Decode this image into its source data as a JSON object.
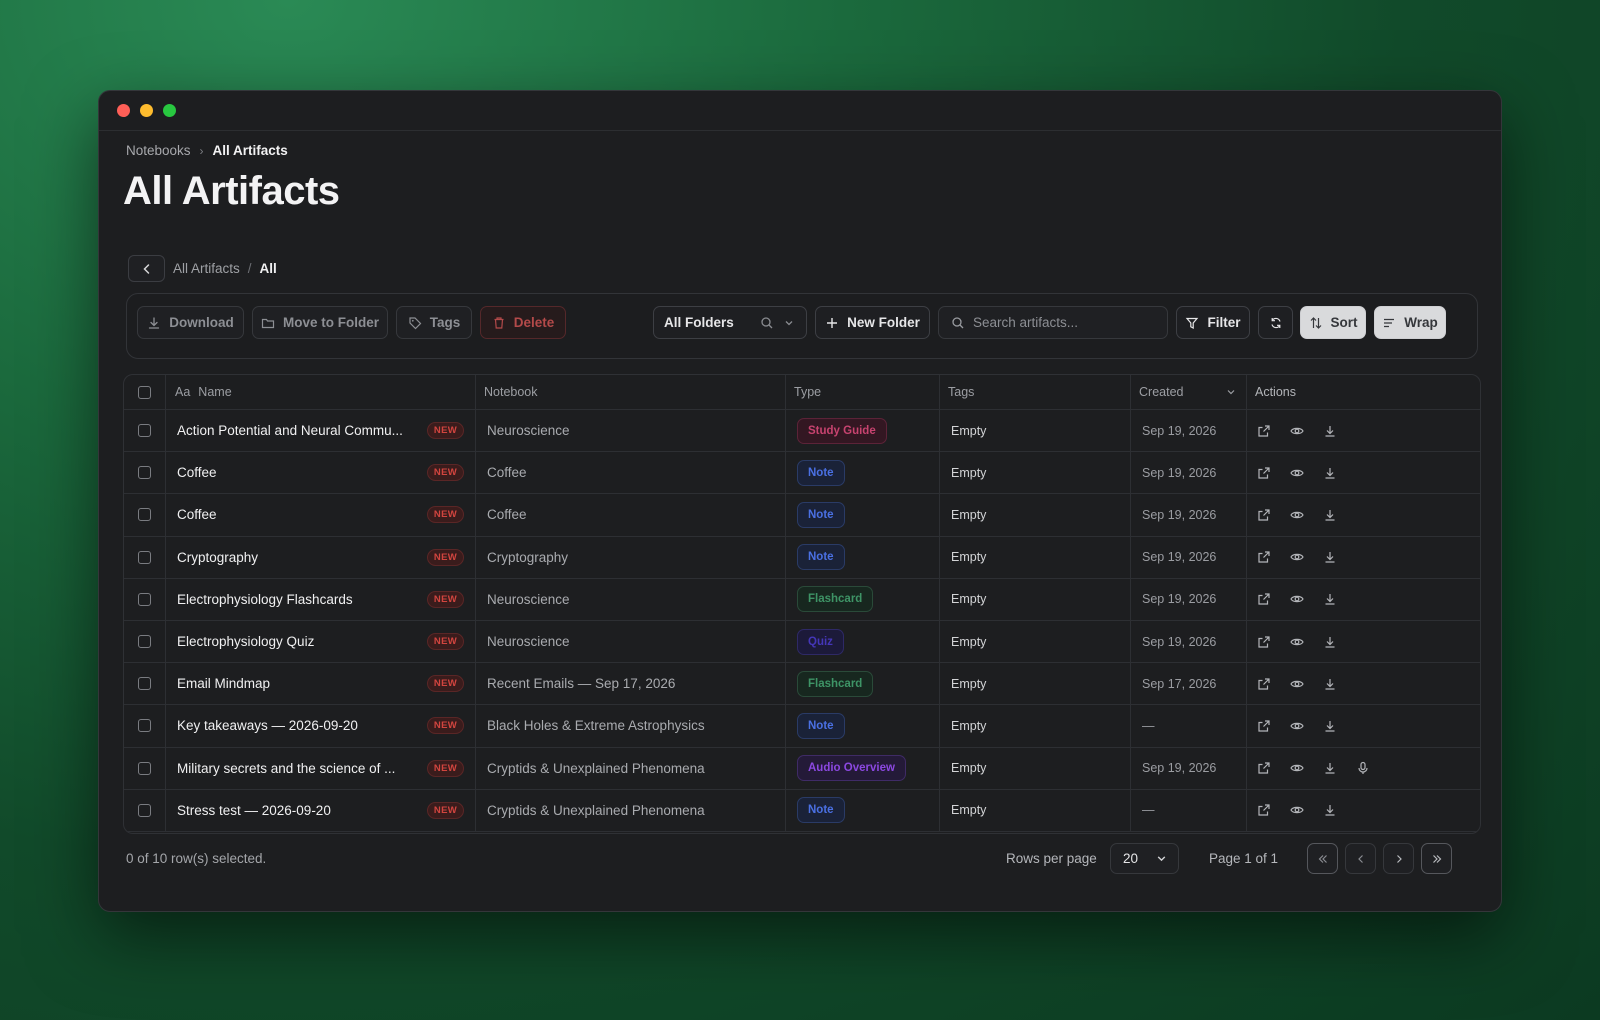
{
  "breadcrumb": {
    "parent": "Notebooks",
    "current": "All Artifacts"
  },
  "page_title": "All Artifacts",
  "subnav": {
    "parent": "All Artifacts",
    "separator": "/",
    "current": "All"
  },
  "toolbar": {
    "download": "Download",
    "move": "Move to Folder",
    "tags": "Tags",
    "delete": "Delete",
    "folder_select": "All Folders",
    "new_folder": "New Folder",
    "search_placeholder": "Search artifacts...",
    "filter": "Filter",
    "sort": "Sort",
    "wrap": "Wrap"
  },
  "columns": {
    "name_prefix": "Aa",
    "name": "Name",
    "notebook": "Notebook",
    "type": "Type",
    "tags": "Tags",
    "created": "Created",
    "actions": "Actions"
  },
  "new_badge": "NEW",
  "rows": [
    {
      "name": "Action Potential and Neural Commu...",
      "notebook": "Neuroscience",
      "type": "Study Guide",
      "type_kind": "study",
      "tags": "Empty",
      "created": "Sep 19, 2026",
      "audio": false
    },
    {
      "name": "Coffee",
      "notebook": "Coffee",
      "type": "Note",
      "type_kind": "note",
      "tags": "Empty",
      "created": "Sep 19, 2026",
      "audio": false
    },
    {
      "name": "Coffee",
      "notebook": "Coffee",
      "type": "Note",
      "type_kind": "note",
      "tags": "Empty",
      "created": "Sep 19, 2026",
      "audio": false
    },
    {
      "name": "Cryptography",
      "notebook": "Cryptography",
      "type": "Note",
      "type_kind": "note",
      "tags": "Empty",
      "created": "Sep 19, 2026",
      "audio": false
    },
    {
      "name": "Electrophysiology Flashcards",
      "notebook": "Neuroscience",
      "type": "Flashcard",
      "type_kind": "flash",
      "tags": "Empty",
      "created": "Sep 19, 2026",
      "audio": false
    },
    {
      "name": "Electrophysiology Quiz",
      "notebook": "Neuroscience",
      "type": "Quiz",
      "type_kind": "quiz",
      "tags": "Empty",
      "created": "Sep 19, 2026",
      "audio": false
    },
    {
      "name": "Email Mindmap",
      "notebook": "Recent Emails — Sep 17, 2026",
      "type": "Flashcard",
      "type_kind": "flash",
      "tags": "Empty",
      "created": "Sep 17, 2026",
      "audio": false
    },
    {
      "name": "Key takeaways — 2026-09-20",
      "notebook": "Black Holes & Extreme Astrophysics",
      "type": "Note",
      "type_kind": "note",
      "tags": "Empty",
      "created": "—",
      "audio": false
    },
    {
      "name": "Military secrets and the science of ...",
      "notebook": "Cryptids & Unexplained Phenomena",
      "type": "Audio Overview",
      "type_kind": "audio",
      "tags": "Empty",
      "created": "Sep 19, 2026",
      "audio": true
    },
    {
      "name": "Stress test — 2026-09-20",
      "notebook": "Cryptids & Unexplained Phenomena",
      "type": "Note",
      "type_kind": "note",
      "tags": "Empty",
      "created": "—",
      "audio": false
    }
  ],
  "footer": {
    "selection": "0 of 10 row(s) selected.",
    "rows_per_page_label": "Rows per page",
    "rows_per_page": "20",
    "page_info": "Page 1 of 1"
  },
  "colors": {
    "accent_new": "#d2453f",
    "study": "#c7436f",
    "note": "#4a70e3",
    "flash": "#3e9466",
    "quiz": "#4436b8",
    "audio": "#8b48e0"
  }
}
